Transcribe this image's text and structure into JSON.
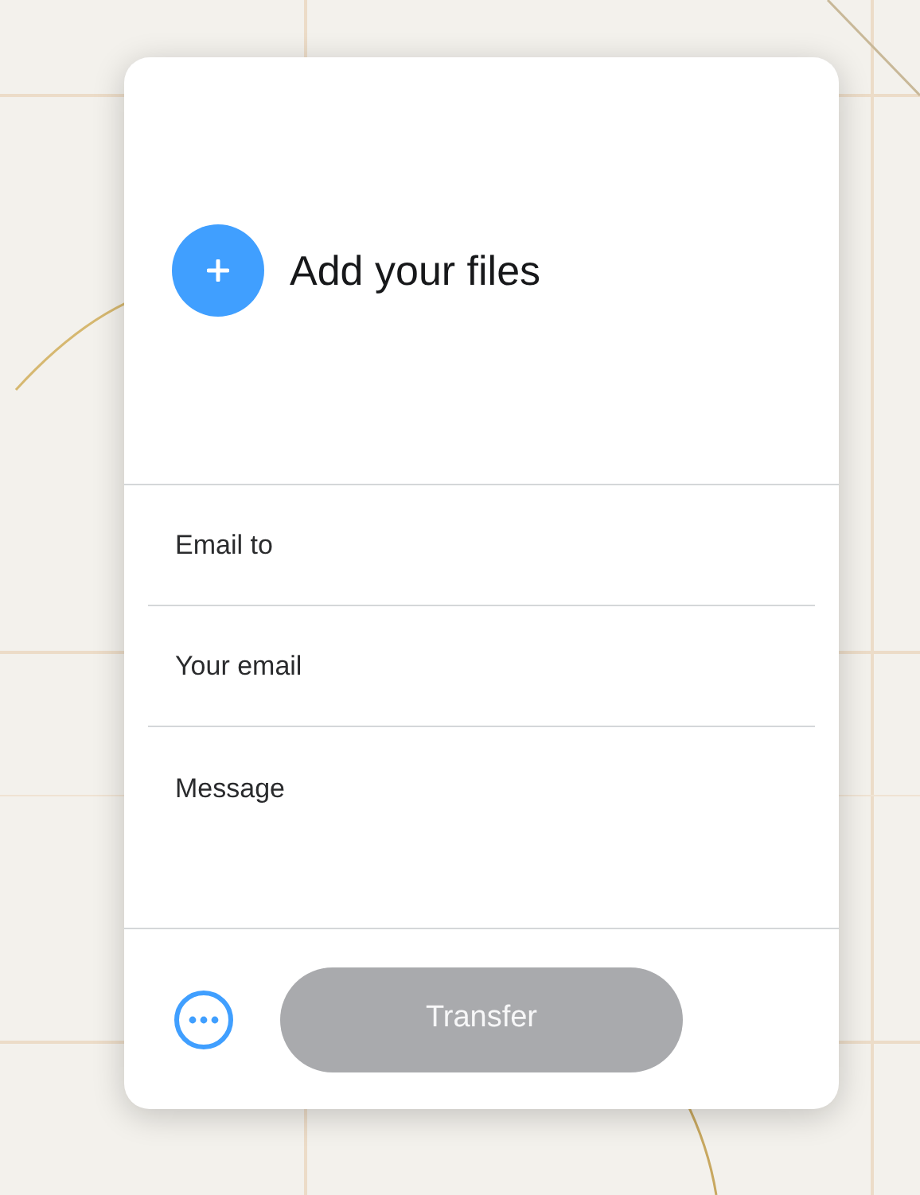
{
  "upload": {
    "label": "Add your files"
  },
  "fields": [
    {
      "kind": "input",
      "placeholder": "Email to"
    },
    {
      "kind": "input",
      "placeholder": "Your email"
    },
    {
      "kind": "textarea",
      "placeholder": "Message"
    }
  ],
  "transfer_button": {
    "label": "Transfer",
    "disabled": true
  }
}
